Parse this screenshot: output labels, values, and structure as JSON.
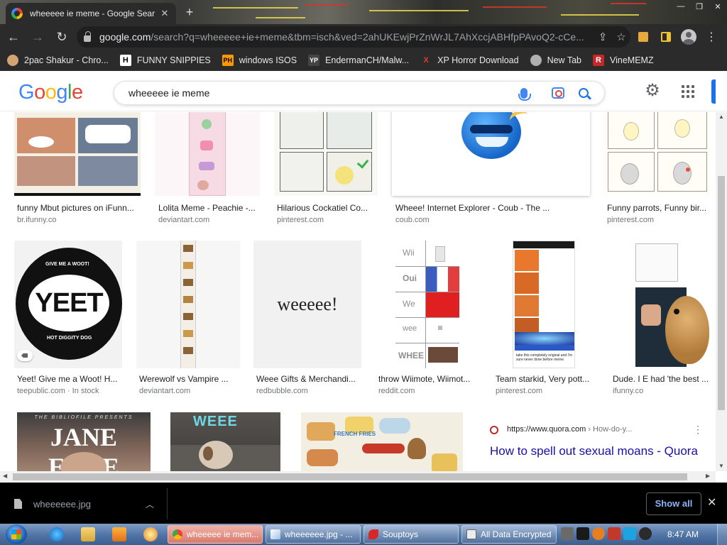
{
  "browser": {
    "tab_title": "wheeeee ie meme - Google Sear",
    "tab_close": "✕",
    "new_tab": "+",
    "url_host": "google.com",
    "url_path": "/search?q=wheeeee+ie+meme&tbm=isch&ved=2ahUKEwjPrZnWrJL7AhXccjABHfpPAvoQ2-cCe...",
    "window_controls": [
      "—",
      "❐",
      "✕"
    ]
  },
  "bookmarks": [
    {
      "label": "2pac Shakur - Chro...",
      "icon": "people-icon",
      "icon_text": "",
      "color": "#d4a373"
    },
    {
      "label": "FUNNY SNIPPIES",
      "icon": "h-logo-icon",
      "icon_text": "H",
      "color": "#ffffff"
    },
    {
      "label": "windows ISOS",
      "icon": "ph-logo-icon",
      "icon_text": "PH",
      "color": "#ff9900"
    },
    {
      "label": "EndermanCH/Malw...",
      "icon": "yp-logo-icon",
      "icon_text": "YP",
      "color": "#444444"
    },
    {
      "label": "XP Horror Download",
      "icon": "x-logo-icon",
      "icon_text": "X",
      "color": "#e53935"
    },
    {
      "label": "New Tab",
      "icon": "globe-icon",
      "icon_text": "",
      "color": "#b0b0b0"
    },
    {
      "label": "VineMEMZ",
      "icon": "r-logo-icon",
      "icon_text": "R",
      "color": "#c62828"
    }
  ],
  "google": {
    "logo_letters": [
      {
        "ch": "G",
        "color": "#4285f4"
      },
      {
        "ch": "o",
        "color": "#ea4335"
      },
      {
        "ch": "o",
        "color": "#fbbc05"
      },
      {
        "ch": "g",
        "color": "#4285f4"
      },
      {
        "ch": "l",
        "color": "#34a853"
      },
      {
        "ch": "e",
        "color": "#ea4335"
      }
    ],
    "query": "wheeeee ie meme",
    "settings_icon": "⚙"
  },
  "results": [
    {
      "caption": "funny Mbut pictures on iFunn...",
      "source": "br.ifunny.co",
      "thumb": "comic-cats"
    },
    {
      "caption": "Lolita Meme - Peachie -...",
      "source": "deviantart.com",
      "thumb": "tall-strip-pink"
    },
    {
      "caption": "Hilarious Cockatiel Co...",
      "source": "pinterest.com",
      "thumb": "cockatiel-comic"
    },
    {
      "caption": "Wheee! Internet Explorer - Coub - The ...",
      "source": "coub.com",
      "thumb": "ie-logo-face"
    },
    {
      "caption": "Funny parrots, Funny bir...",
      "source": "pinterest.com",
      "thumb": "parrot-comic"
    },
    {
      "caption": "Yeet! Give me a Woot! H...",
      "source": "teepublic.com",
      "source_extra": " · In stock",
      "thumb": "yeet-sticker",
      "sticker_text": "YEET",
      "sticker_top": "GIVE ME A WOOT!",
      "sticker_bottom": "HOT DIGGITY DOG"
    },
    {
      "caption": "Werewolf vs Vampire ...",
      "source": "deviantart.com",
      "thumb": "tall-strip-brown"
    },
    {
      "caption": "Weee Gifts & Merchandi...",
      "source": "redbubble.com",
      "thumb": "weeee-text",
      "thumb_text": "weeeee!"
    },
    {
      "caption": "throw Wiimote, Wiimot...",
      "source": "reddit.com",
      "thumb": "wii-chart",
      "wii_labels": [
        "Wii",
        "Oui",
        "We",
        "wee",
        "WHEE"
      ]
    },
    {
      "caption": "Team starkid, Very pott...",
      "source": "pinterest.com",
      "thumb": "drake-brain-meme",
      "meme_caption": "take this completely original and I'm sure never done before meme"
    },
    {
      "caption": "Dude. I E had 'the best ...",
      "source": "ifunny.co",
      "thumb": "hamster-meme"
    },
    {
      "caption": "",
      "source": "",
      "thumb": "jane-eyre",
      "thumb_top": "THE BIBLIOFILE PRESENTS",
      "thumb_text": "JANE EYRE"
    },
    {
      "caption": "",
      "source": "",
      "thumb": "puppy-weee",
      "thumb_text": "WEEE"
    },
    {
      "caption": "",
      "source": "",
      "thumb": "food-stickers",
      "thumb_text": "FRENCH FRIES"
    }
  ],
  "quora": {
    "url": "https://www.quora.com",
    "path": " › How-do-y...",
    "title": "How to spell out sexual moans - Quora",
    "menu": "⋮"
  },
  "download": {
    "filename": "wheeeeee.jpg",
    "show_all": "Show all",
    "close": "✕"
  },
  "taskbar": {
    "buttons": [
      {
        "label": "wheeeee ie mem...",
        "icon": "chrome-icon",
        "active": true
      },
      {
        "label": "wheeeeee.jpg - ...",
        "icon": "paint-icon",
        "active": false
      },
      {
        "label": "Souptoys",
        "icon": "souptoys-icon",
        "active": false
      },
      {
        "label": "All Data Encrypted",
        "icon": "app-window-icon",
        "active": false
      }
    ],
    "clock": "8:47 AM"
  }
}
